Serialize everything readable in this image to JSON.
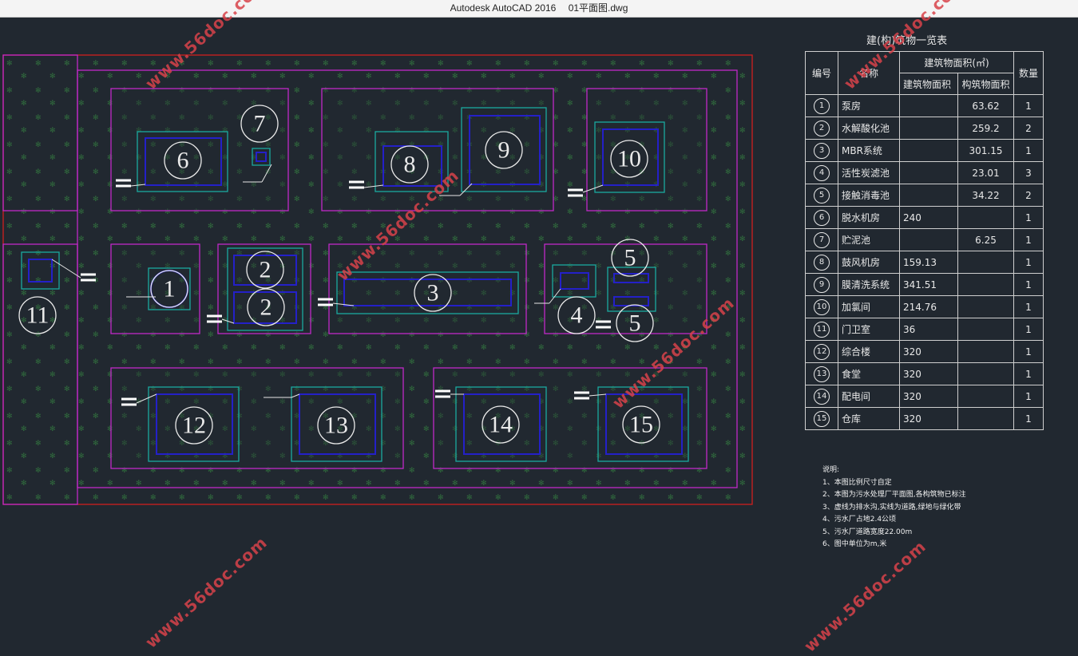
{
  "window": {
    "app": "Autodesk AutoCAD 2016",
    "file": "01平面图.dwg"
  },
  "table": {
    "title": "建(构)筑物一览表",
    "headers": {
      "no": "编号",
      "name": "名称",
      "area": "建筑物面积(㎡)",
      "bldg_area": "建筑物面积",
      "struct_area": "构筑物面积",
      "qty": "数量"
    },
    "rows": [
      {
        "no": "1",
        "name": "泵房",
        "bldg_area": "",
        "struct_area": "63.62",
        "qty": "1"
      },
      {
        "no": "2",
        "name": "水解酸化池",
        "bldg_area": "",
        "struct_area": "259.2",
        "qty": "2"
      },
      {
        "no": "3",
        "name": "MBR系统",
        "bldg_area": "",
        "struct_area": "301.15",
        "qty": "1"
      },
      {
        "no": "4",
        "name": "活性炭滤池",
        "bldg_area": "",
        "struct_area": "23.01",
        "qty": "3"
      },
      {
        "no": "5",
        "name": "接触消毒池",
        "bldg_area": "",
        "struct_area": "34.22",
        "qty": "2"
      },
      {
        "no": "6",
        "name": "脱水机房",
        "bldg_area": "240",
        "struct_area": "",
        "qty": "1"
      },
      {
        "no": "7",
        "name": "贮泥池",
        "bldg_area": "",
        "struct_area": "6.25",
        "qty": "1"
      },
      {
        "no": "8",
        "name": "鼓风机房",
        "bldg_area": "159.13",
        "struct_area": "",
        "qty": "1"
      },
      {
        "no": "9",
        "name": "膜清洗系统",
        "bldg_area": "341.51",
        "struct_area": "",
        "qty": "1"
      },
      {
        "no": "10",
        "name": "加氯间",
        "bldg_area": "214.76",
        "struct_area": "",
        "qty": "1"
      },
      {
        "no": "11",
        "name": "门卫室",
        "bldg_area": "36",
        "struct_area": "",
        "qty": "1"
      },
      {
        "no": "12",
        "name": "综合楼",
        "bldg_area": "320",
        "struct_area": "",
        "qty": "1"
      },
      {
        "no": "13",
        "name": "食堂",
        "bldg_area": "320",
        "struct_area": "",
        "qty": "1"
      },
      {
        "no": "14",
        "name": "配电间",
        "bldg_area": "320",
        "struct_area": "",
        "qty": "1"
      },
      {
        "no": "15",
        "name": "仓库",
        "bldg_area": "320",
        "struct_area": "",
        "qty": "1"
      }
    ]
  },
  "notes": [
    "说明:",
    "1、本图比例尺寸自定",
    "2、本图为污水处理厂平面图,各构筑物已标注",
    "3、虚线为排水沟,实线为道路,绿地与绿化带",
    "4、污水厂占地2.4公顷",
    "5、污水厂道路宽度22.00m",
    "6、图中单位为m,米"
  ],
  "plan_labels": [
    "1",
    "2",
    "2",
    "3",
    "4",
    "5",
    "5",
    "6",
    "7",
    "8",
    "9",
    "10",
    "11",
    "12",
    "13",
    "14",
    "15"
  ],
  "watermark": "www.56doc.com",
  "colors": {
    "background": "#212830",
    "site_boundary": "#d01f1f",
    "plot": "#c028c8",
    "building_outer": "#1aa9a0",
    "building_inner": "#2420c8",
    "grass": "#2d6a3a"
  }
}
